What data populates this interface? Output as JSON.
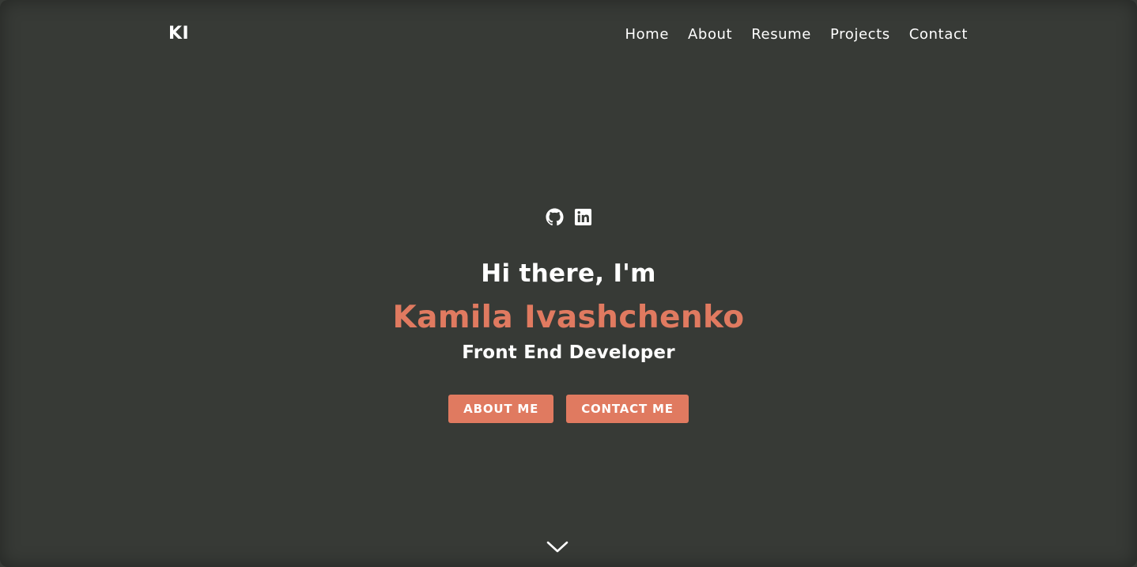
{
  "nav": {
    "logo": "KI",
    "links": [
      "Home",
      "About",
      "Resume",
      "Projects",
      "Contact"
    ]
  },
  "hero": {
    "socials": [
      "github-icon",
      "linkedin-icon"
    ],
    "greeting": "Hi there, I'm",
    "name": "Kamila Ivashchenko",
    "role": "Front End Developer",
    "buttons": {
      "about": "ABOUT ME",
      "contact": "CONTACT ME"
    },
    "scroll_icon": "chevron-down-icon"
  },
  "colors": {
    "background": "#373a36",
    "accent": "#e07a60",
    "text": "#ffffff"
  }
}
